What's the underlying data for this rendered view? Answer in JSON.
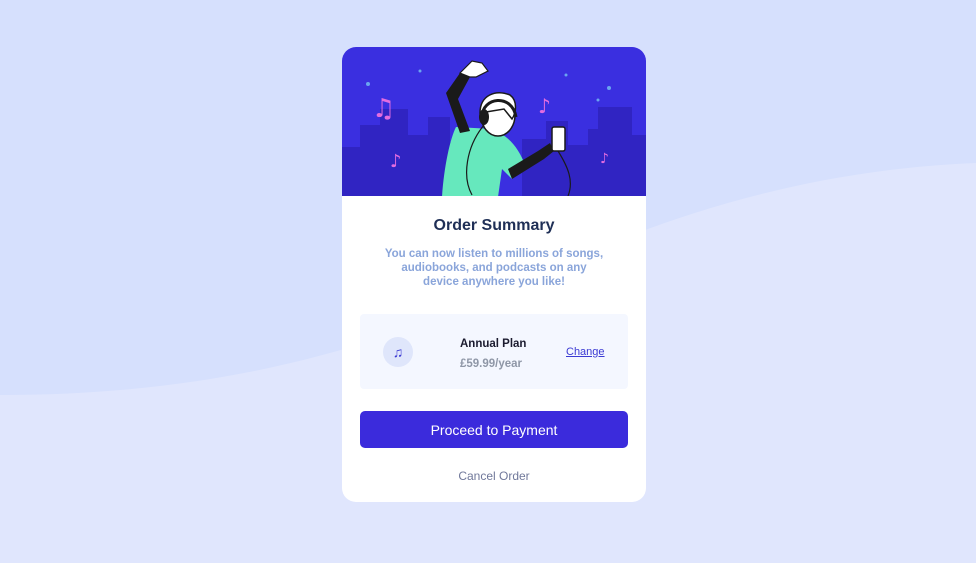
{
  "colors": {
    "page_background": "#e0e6fd",
    "wave": "#d6e0fd",
    "accent": "#3b2bdc",
    "hero_background": "#3a2fe0",
    "title": "#1f2f56",
    "description": "#8aa5da",
    "muted": "#70789a"
  },
  "card": {
    "title": "Order Summary",
    "description": "You can now listen to millions of songs, audiobooks, and podcasts on any device anywhere you like!",
    "hero_illustration": "person-dancing-with-headphones-illustration"
  },
  "plan": {
    "icon": "music-note-icon",
    "icon_glyph": "♫",
    "name": "Annual Plan",
    "price": "£59.99/year",
    "change_label": "Change"
  },
  "actions": {
    "proceed_label": "Proceed to Payment",
    "cancel_label": "Cancel Order"
  }
}
